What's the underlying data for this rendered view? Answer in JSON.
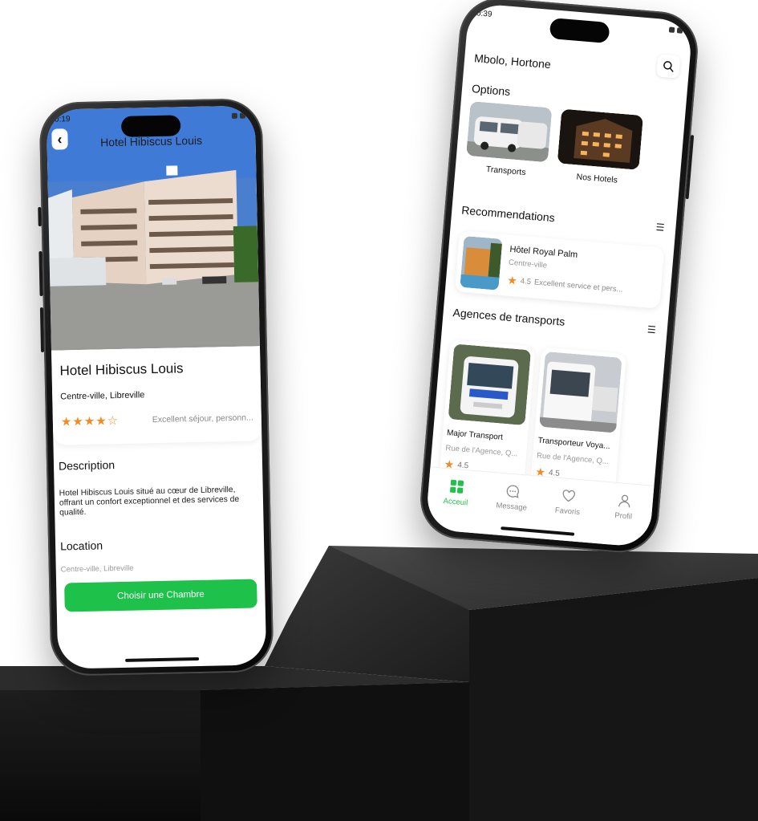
{
  "left_screen": {
    "status_time": "0:19",
    "header_title": "Hotel Hibiscus Louis",
    "hotel_name": "Hotel Hibiscus Louis",
    "hotel_location": "Centre-ville, Libreville",
    "rating_stars": 4,
    "rating_max": 5,
    "review_snippet": "Excellent séjour, personn...",
    "description_heading": "Description",
    "description_text": "Hotel Hibiscus Louis situé au cœur de Libreville, offrant un confort exceptionnel et des services de qualité.",
    "location_heading": "Location",
    "location_text": "Centre-ville, Libreville",
    "cta_label": "Choisir une Chambre",
    "accent_color": "#1ec24a"
  },
  "right_screen": {
    "status_time": "0:39",
    "greeting": "Mbolo, Hortone",
    "options_heading": "Options",
    "options": [
      {
        "label": "Transports",
        "icon": "minibus-photo"
      },
      {
        "label": "Nos Hotels",
        "icon": "hotel-night-photo"
      }
    ],
    "recommendations_heading": "Recommendations",
    "recommendation": {
      "name": "Hôtel Royal Palm",
      "area": "Centre-ville",
      "rating": "4.5",
      "review": "Excellent service et pers..."
    },
    "agencies_heading": "Agences de transports",
    "agencies": [
      {
        "name": "Major Transport",
        "address": "Rue de l'Agence, Q...",
        "rating": "4.5"
      },
      {
        "name": "Transporteur Voya...",
        "address": "Rue de l'Agence, Q...",
        "rating": "4.5"
      }
    ],
    "tabs": [
      {
        "label": "Acceuil",
        "icon": "grid-icon",
        "active": true
      },
      {
        "label": "Message",
        "icon": "chat-icon",
        "active": false
      },
      {
        "label": "Favoris",
        "icon": "heart-icon",
        "active": false
      },
      {
        "label": "Profil",
        "icon": "user-icon",
        "active": false
      }
    ],
    "star_color": "#f28b22"
  }
}
